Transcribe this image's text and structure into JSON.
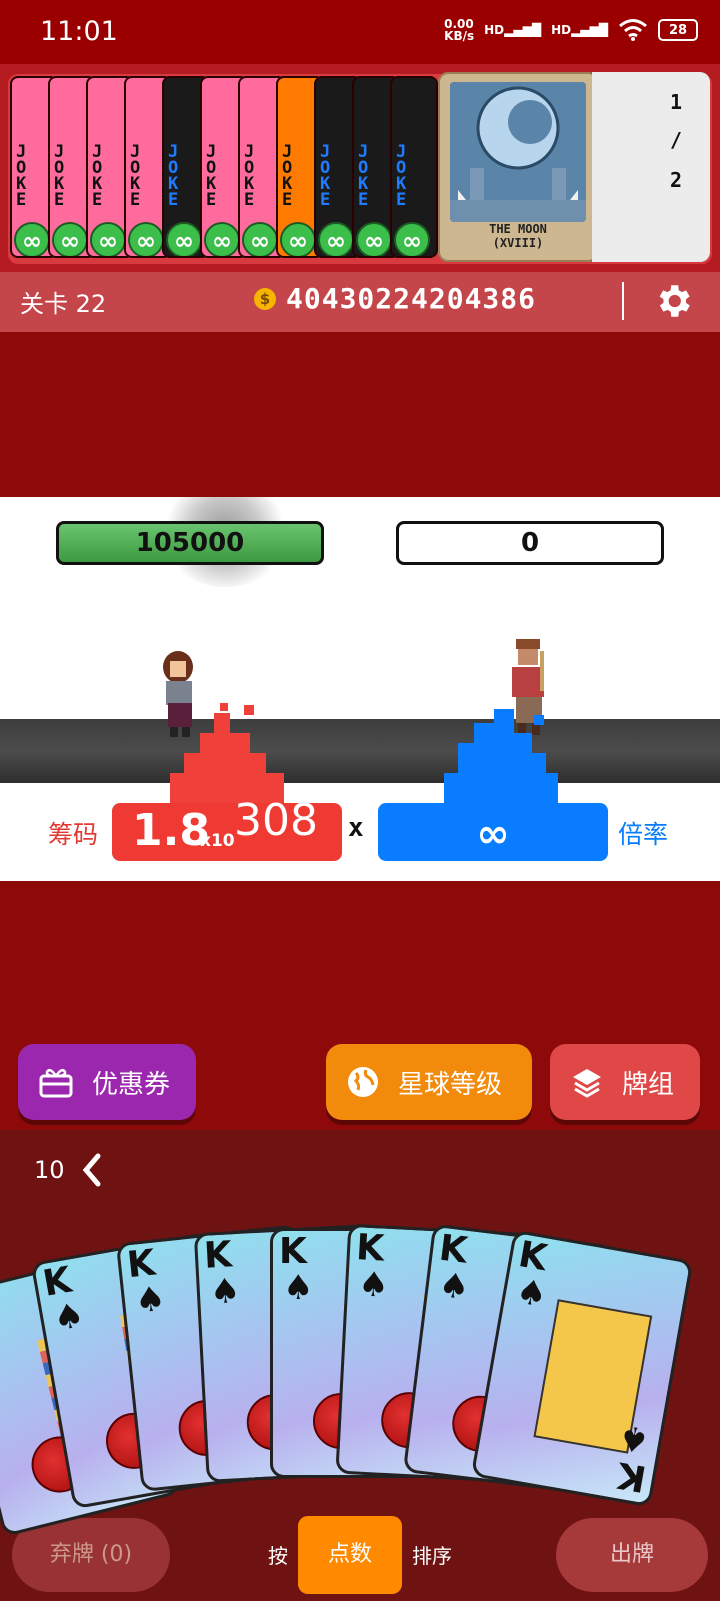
{
  "status_bar": {
    "time": "11:01",
    "net_speed_value": "0.00",
    "net_speed_unit": "KB/s",
    "signal1": "HD",
    "signal2": "HD",
    "battery": "28"
  },
  "jokers": {
    "card_text": "JOKE",
    "infinity_badge": "∞",
    "colors": [
      "#ff6b9d",
      "#ff6b9d",
      "#ff6b9d",
      "#ff6b9d",
      "#1a1a1a",
      "#ff6b9d",
      "#ff6b9d",
      "#ff7a00",
      "#1a1a1a",
      "#1a1a1a",
      "#1a1a1a"
    ],
    "featured_card": {
      "title": "THE MOON",
      "subtitle": "(XVIII)"
    },
    "page_indicator": {
      "current": "1",
      "separator": "/",
      "total": "2"
    }
  },
  "level_bar": {
    "level_label": "关卡 22",
    "coin_icon": "$",
    "money": "40430224204386"
  },
  "battle": {
    "hp_left": "105000",
    "hp_right": "0",
    "chips_label": "筹码",
    "chips_mantissa": "1.8",
    "chips_x10": "x10",
    "chips_exponent": "308",
    "times_sign": "x",
    "mult_value": "∞",
    "mult_label": "倍率"
  },
  "actions": {
    "coupon": "优惠券",
    "planet": "星球等级",
    "deck": "牌组"
  },
  "hand": {
    "deck_count": "10",
    "cards": [
      {
        "rank": "K",
        "suit": "♠"
      },
      {
        "rank": "K",
        "suit": "♠"
      },
      {
        "rank": "K",
        "suit": "♠"
      },
      {
        "rank": "K",
        "suit": "♠"
      },
      {
        "rank": "K",
        "suit": "♠"
      },
      {
        "rank": "K",
        "suit": "♠"
      },
      {
        "rank": "K",
        "suit": "♠"
      },
      {
        "rank": "K",
        "suit": "♠"
      }
    ]
  },
  "controls": {
    "discard": "弃牌 (0)",
    "sort_prefix": "按",
    "sort_points": "点数",
    "sort_suffix": "排序",
    "play": "出牌"
  }
}
